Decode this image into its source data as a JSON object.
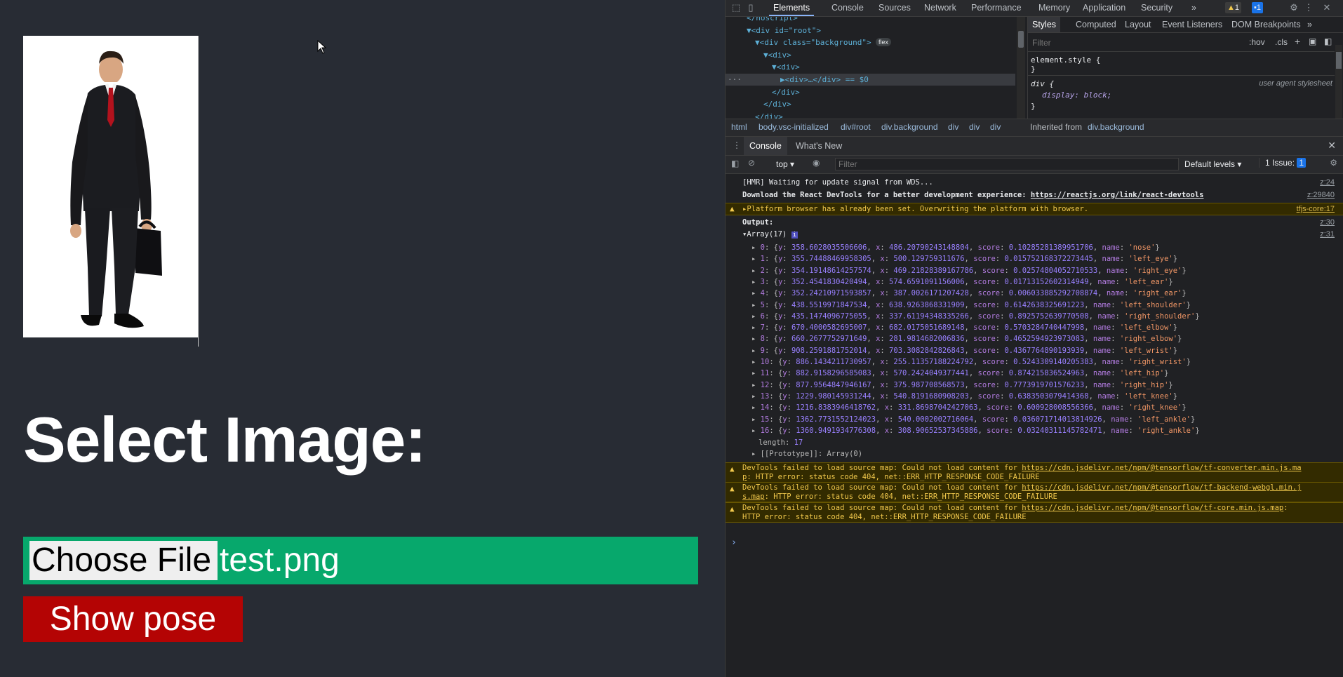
{
  "page": {
    "title": "Select Image:",
    "choose_file": "Choose File",
    "file_name": "test.png",
    "show_pose": "Show pose"
  },
  "devtools": {
    "tabs": [
      "Elements",
      "Console",
      "Sources",
      "Network",
      "Performance",
      "Memory",
      "Application",
      "Security"
    ],
    "more_tabs": "»",
    "warn_count": "1",
    "info_count": "1",
    "tree": [
      {
        "indent": 0,
        "html": "</noscript>"
      },
      {
        "indent": 0,
        "html": "▼<div id=\"root\">"
      },
      {
        "indent": 1,
        "html": "▼<div class=\"background\">",
        "badge": "flex"
      },
      {
        "indent": 2,
        "html": "▼<div>"
      },
      {
        "indent": 3,
        "html": "▼<div>"
      },
      {
        "indent": 4,
        "html": "▶<div>…</div> == $0",
        "selected": true
      },
      {
        "indent": 3,
        "html": "</div>"
      },
      {
        "indent": 2,
        "html": "</div>"
      },
      {
        "indent": 1,
        "html": "</div>"
      }
    ],
    "style_tabs": [
      "Styles",
      "Computed",
      "Layout",
      "Event Listeners",
      "DOM Breakpoints"
    ],
    "styles_filter": "Filter",
    "styles_hov": ":hov",
    "styles_cls": ".cls",
    "style_rules": [
      "element.style {",
      "}",
      "div {",
      "display: block;",
      "}"
    ],
    "user_agent": "user agent stylesheet",
    "breadcrumbs": [
      "html",
      "body.vsc-initialized",
      "div#root",
      "div.background",
      "div",
      "div",
      "div"
    ],
    "inherited_label": "Inherited from",
    "inherited_from": "div.background",
    "drawer_tabs": [
      "Console",
      "What's New"
    ],
    "context": "top",
    "console_filter": "Filter",
    "default_levels": "Default levels",
    "issues": "1 Issue:",
    "issues_count": "1",
    "console": {
      "hmr": "[HMR] Waiting for update signal from WDS...",
      "hmr_src": "z:24",
      "react": "Download the React DevTools for a better development experience: ",
      "react_link": "https://reactjs.org/link/react-devtools",
      "react_src": "z:29840",
      "platform": "Platform browser has already been set. Overwriting the platform with browser.",
      "platform_src": "tfjs-core:17",
      "output": "Output:",
      "output_src": "z:30",
      "array_label": "Array(17)",
      "array_src": "z:31",
      "keypoints": [
        {
          "i": "0",
          "y": "358.6028035506606",
          "x": "486.20790243148804",
          "score": "0.10285281389951706",
          "name": "'nose'"
        },
        {
          "i": "1",
          "y": "355.74488469958305",
          "x": "500.129759311676",
          "score": "0.015752168372273445",
          "name": "'left_eye'"
        },
        {
          "i": "2",
          "y": "354.19148614257574",
          "x": "469.21828389167786",
          "score": "0.02574804052710533",
          "name": "'right_eye'"
        },
        {
          "i": "3",
          "y": "352.4541830420494",
          "x": "574.6591091156006",
          "score": "0.01713152602314949",
          "name": "'left_ear'"
        },
        {
          "i": "4",
          "y": "352.24210971593857",
          "x": "387.0026171207428",
          "score": "0.006033885292708874",
          "name": "'right_ear'"
        },
        {
          "i": "5",
          "y": "438.5519971847534",
          "x": "638.9263868331909",
          "score": "0.6142638325691223",
          "name": "'left_shoulder'"
        },
        {
          "i": "6",
          "y": "435.1474096775055",
          "x": "337.61194348335266",
          "score": "0.8925752639770508",
          "name": "'right_shoulder'"
        },
        {
          "i": "7",
          "y": "670.4000582695007",
          "x": "682.0175051689148",
          "score": "0.5703284740447998",
          "name": "'left_elbow'"
        },
        {
          "i": "8",
          "y": "660.2677752971649",
          "x": "281.9814682006836",
          "score": "0.4652594923973083",
          "name": "'right_elbow'"
        },
        {
          "i": "9",
          "y": "908.2591881752014",
          "x": "703.3082842826843",
          "score": "0.4367764890193939",
          "name": "'left_wrist'"
        },
        {
          "i": "10",
          "y": "886.1434211730957",
          "x": "255.11357188224792",
          "score": "0.5243309140205383",
          "name": "'right_wrist'"
        },
        {
          "i": "11",
          "y": "882.9158296585083",
          "x": "570.2424049377441",
          "score": "0.874215836524963",
          "name": "'left_hip'"
        },
        {
          "i": "12",
          "y": "877.9564847946167",
          "x": "375.987708568573",
          "score": "0.7773919701576233",
          "name": "'right_hip'"
        },
        {
          "i": "13",
          "y": "1229.980145931244",
          "x": "540.8191680908203",
          "score": "0.6383503079414368",
          "name": "'left_knee'"
        },
        {
          "i": "14",
          "y": "1216.8383946418762",
          "x": "331.86987042427063",
          "score": "0.600928008556366",
          "name": "'right_knee'"
        },
        {
          "i": "15",
          "y": "1362.7731552124023",
          "x": "540.0002002716064",
          "score": "0.036071714013814926",
          "name": "'left_ankle'"
        },
        {
          "i": "16",
          "y": "1360.9491934776308",
          "x": "308.90652537345886",
          "score": "0.03240311145782471",
          "name": "'right_ankle'"
        }
      ],
      "length_label": "length",
      "length_value": "17",
      "prototype": "[[Prototype]]: Array(0)",
      "sourcemap_errors": [
        {
          "pre": "DevTools failed to load source map: Could not load content for ",
          "link": "https://cdn.jsdelivr.net/npm/@tensorflow/tf-converter.min.js.ma",
          "cont": "p",
          "post": ": HTTP error: status code 404, net::ERR_HTTP_RESPONSE_CODE_FAILURE"
        },
        {
          "pre": "DevTools failed to load source map: Could not load content for ",
          "link": "https://cdn.jsdelivr.net/npm/@tensorflow/tf-backend-webgl.min.j",
          "cont": "s.map",
          "post": ": HTTP error: status code 404, net::ERR_HTTP_RESPONSE_CODE_FAILURE"
        },
        {
          "pre": "DevTools failed to load source map: Could not load content for ",
          "link": "https://cdn.jsdelivr.net/npm/@tensorflow/tf-core.min.js.map",
          "cont": "",
          "post": ":\nHTTP error: status code 404, net::ERR_HTTP_RESPONSE_CODE_FAILURE"
        }
      ],
      "prompt": "›"
    }
  }
}
